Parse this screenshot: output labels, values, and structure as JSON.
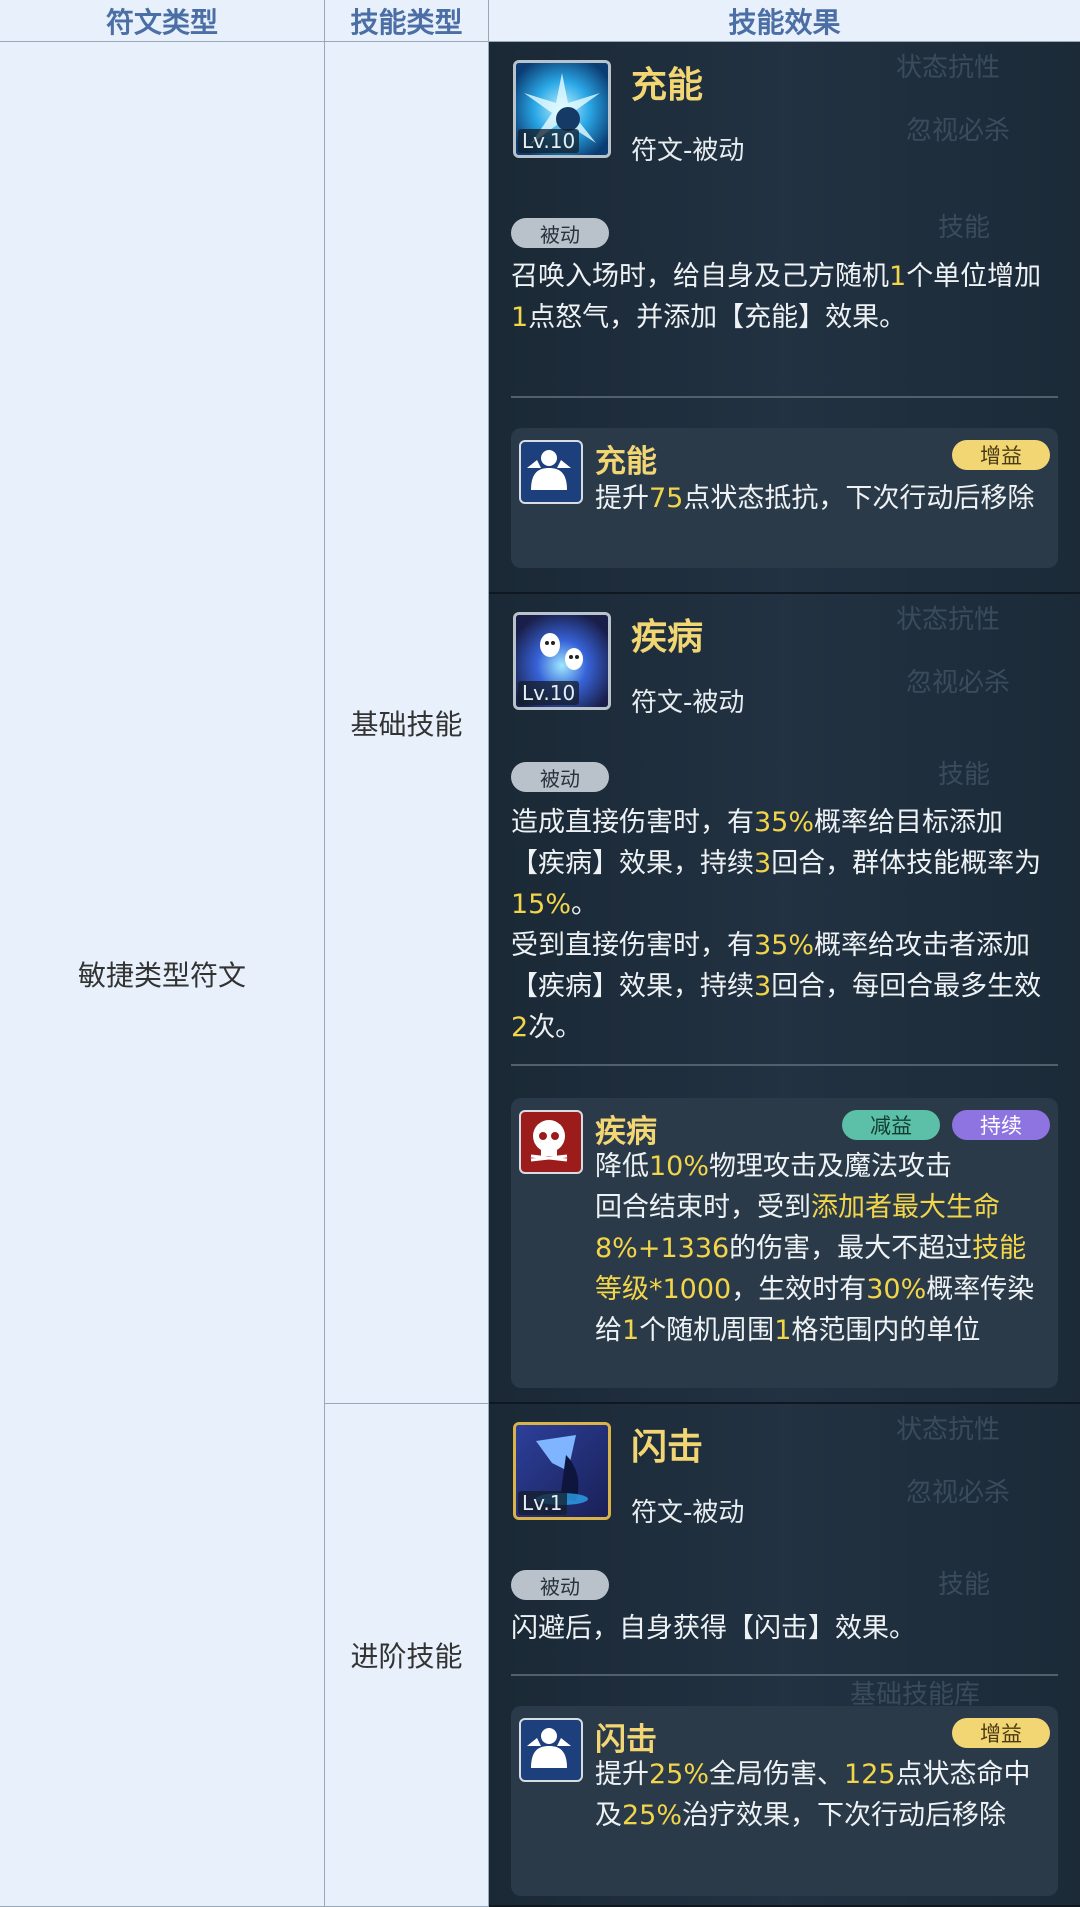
{
  "table": {
    "headers": [
      "符文类型",
      "技能类型",
      "技能效果"
    ],
    "rune_type": "敏捷类型符文",
    "basic_skill": "基础技能",
    "advanced_skill": "进阶技能"
  },
  "ghost_text": {
    "status_resist": "状态抗性",
    "ignore_crit": "忽视必杀",
    "skill": "技能",
    "basic_skill_lib": "基础技能库"
  },
  "skills": [
    {
      "name": "充能",
      "level": "Lv.10",
      "sub": "符文-被动",
      "passive_badge": "被动",
      "desc_parts": [
        "召唤入场时，给自身及己方随机",
        "1",
        "个单位增加",
        "1",
        "点怒气，并添加【充能】效果。"
      ],
      "effect": {
        "name": "充能",
        "tags": [
          "增益"
        ],
        "desc_parts": [
          "提升",
          "75",
          "点状态抵抗，下次行动后移除"
        ]
      }
    },
    {
      "name": "疾病",
      "level": "Lv.10",
      "sub": "符文-被动",
      "passive_badge": "被动",
      "desc_parts": [
        "造成直接伤害时，有",
        "35%",
        "概率给目标添加【疾病】效果，持续",
        "3",
        "回合，群体技能概率为",
        "15%",
        "。"
      ],
      "desc2_parts": [
        "受到直接伤害时，有",
        "35%",
        "概率给攻击者添加【疾病】效果，持续",
        "3",
        "回合，每回合最多生效",
        "2",
        "次。"
      ],
      "effect": {
        "name": "疾病",
        "tags": [
          "减益",
          "持续"
        ],
        "desc_parts": [
          "降低",
          "10%",
          "物理攻击及魔法攻击"
        ],
        "desc2_parts": [
          "回合结束时，受到",
          "添加者最大生命8%+1336",
          "的伤害，最大不超过",
          "技能等级*1000",
          "，生效时有",
          "30%",
          "概率传染给",
          "1",
          "个随机周围",
          "1",
          "格范围内的单位"
        ]
      }
    },
    {
      "name": "闪击",
      "level": "Lv.1",
      "sub": "符文-被动",
      "passive_badge": "被动",
      "desc_parts": [
        "闪避后，自身获得【闪击】效果。"
      ],
      "effect": {
        "name": "闪击",
        "tags": [
          "增益"
        ],
        "desc_parts": [
          "提升",
          "25%",
          "全局伤害、",
          "125",
          "点状态命中及",
          "25%",
          "治疗效果，下次行动后移除"
        ]
      }
    }
  ],
  "colors": {
    "header_bg": "#e8f0fb",
    "header_text": "#4b6fa5",
    "panel_bg": "#1f2e3d",
    "highlight": "#f3d54a"
  }
}
